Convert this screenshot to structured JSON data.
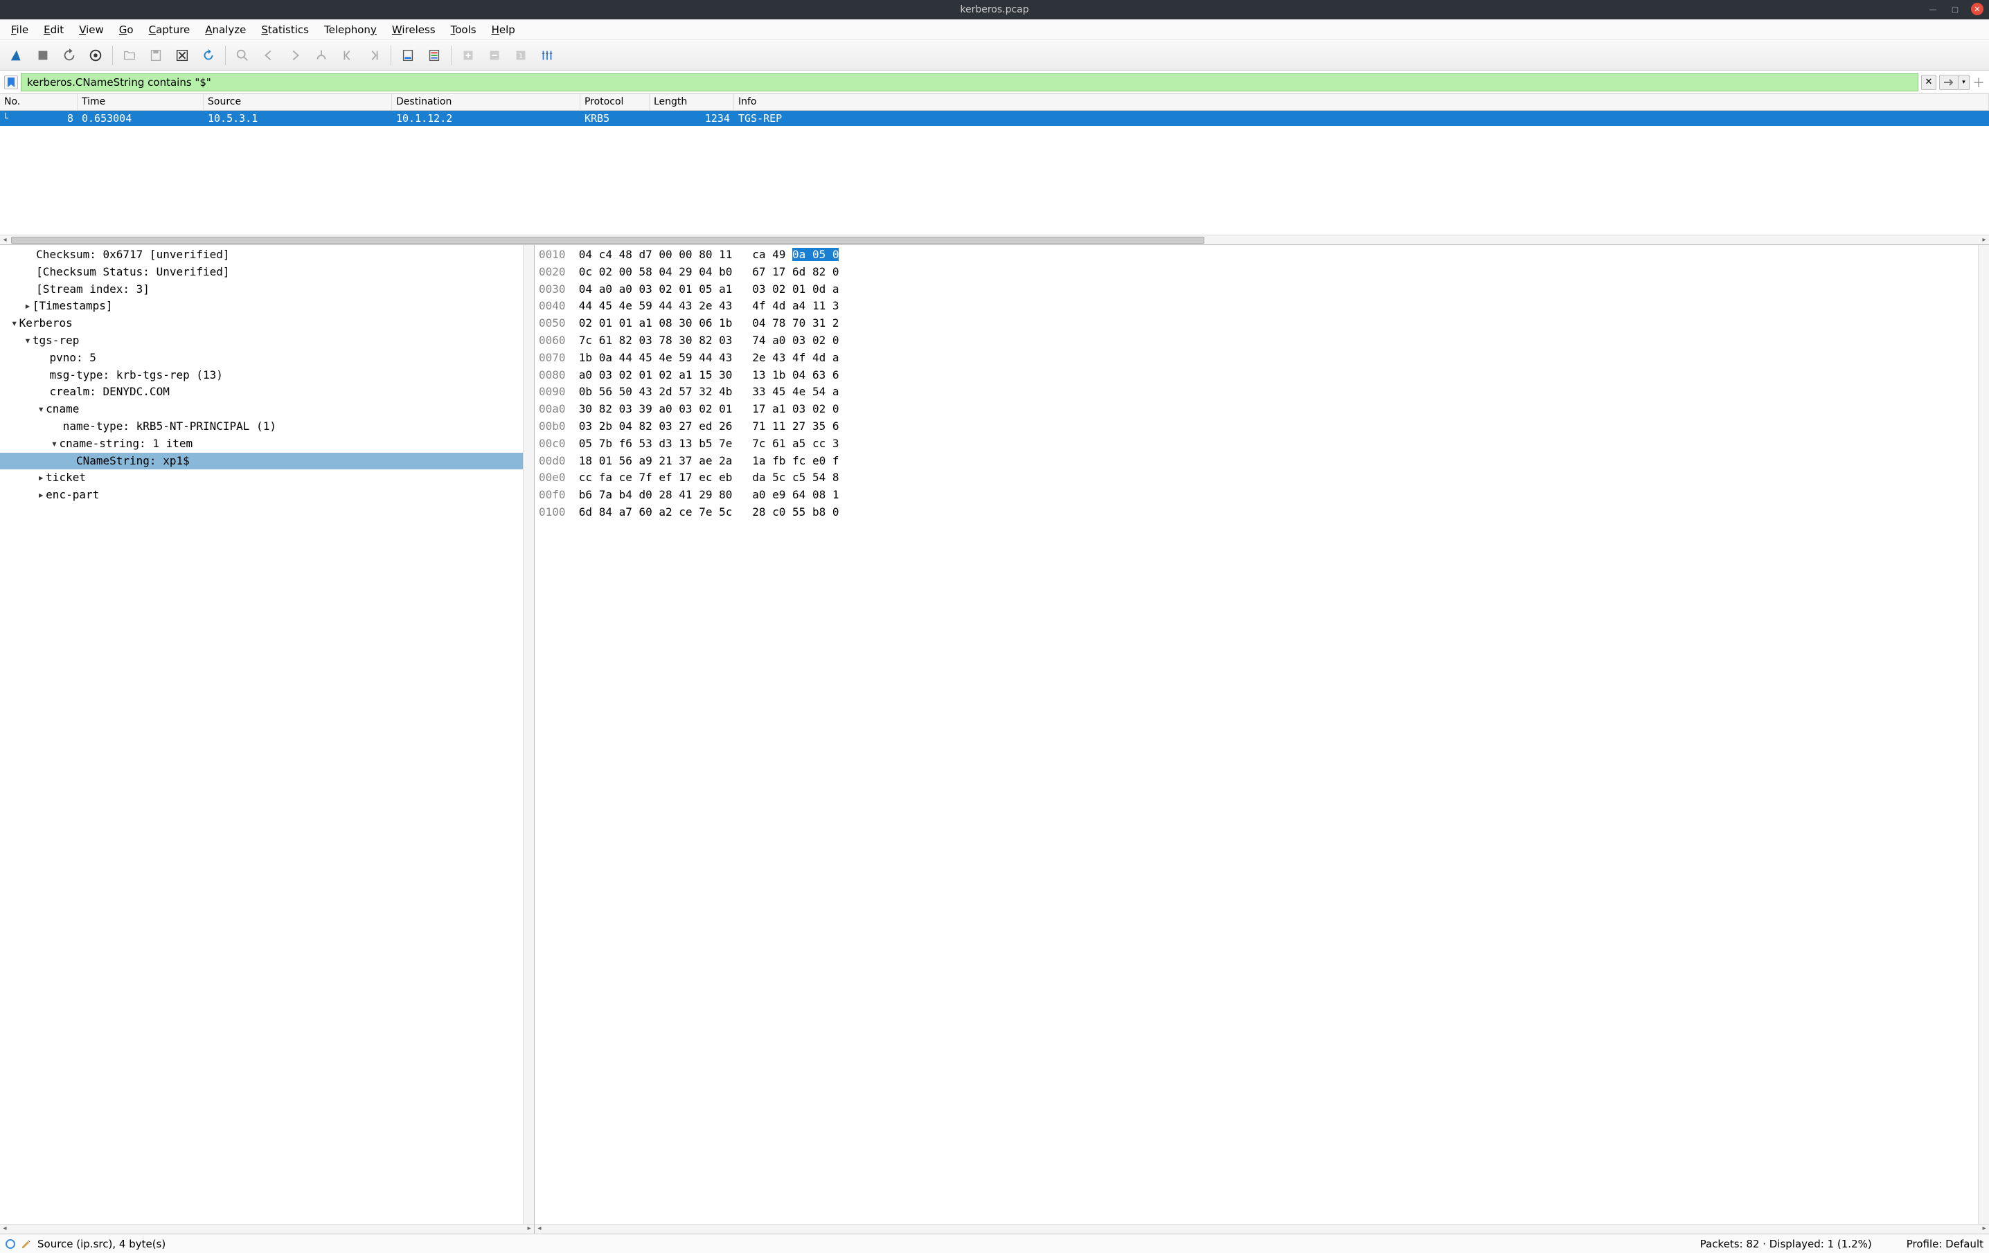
{
  "titlebar": {
    "title": "kerberos.pcap"
  },
  "menubar": {
    "file": "File",
    "edit": "Edit",
    "view": "View",
    "go": "Go",
    "capture": "Capture",
    "analyze": "Analyze",
    "statistics": "Statistics",
    "telephony": "Telephony",
    "wireless": "Wireless",
    "tools": "Tools",
    "help": "Help"
  },
  "filter": {
    "value": "kerberos.CNameString contains \"$\""
  },
  "packet_cols": {
    "no": "No.",
    "time": "Time",
    "source": "Source",
    "destination": "Destination",
    "protocol": "Protocol",
    "length": "Length",
    "info": "Info"
  },
  "packets": [
    {
      "no": "8",
      "time": "0.653004",
      "source": "10.5.3.1",
      "destination": "10.1.12.2",
      "protocol": "KRB5",
      "length": "1234",
      "info": "TGS-REP"
    }
  ],
  "tree": {
    "l0": "Checksum: 0x6717 [unverified]",
    "l1": "[Checksum Status: Unverified]",
    "l2": "[Stream index: 3]",
    "l3": "[Timestamps]",
    "l4": "Kerberos",
    "l5": "tgs-rep",
    "l6": "pvno: 5",
    "l7": "msg-type: krb-tgs-rep (13)",
    "l8": "crealm: DENYDC.COM",
    "l9": "cname",
    "l10": "name-type: kRB5-NT-PRINCIPAL (1)",
    "l11": "cname-string: 1 item",
    "l12": "CNameString: xp1$",
    "l13": "ticket",
    "l14": "enc-part"
  },
  "hex": {
    "rows": [
      {
        "off": "0010",
        "a": "04 c4 48 d7 00 00 80 11",
        "b": "ca 49 ",
        "hl": "0a 05 0"
      },
      {
        "off": "0020",
        "a": "0c 02 00 58 04 29 04 b0",
        "b": "67 17 6d 82 0"
      },
      {
        "off": "0030",
        "a": "04 a0 a0 03 02 01 05 a1",
        "b": "03 02 01 0d a"
      },
      {
        "off": "0040",
        "a": "44 45 4e 59 44 43 2e 43",
        "b": "4f 4d a4 11 3"
      },
      {
        "off": "0050",
        "a": "02 01 01 a1 08 30 06 1b",
        "b": "04 78 70 31 2"
      },
      {
        "off": "0060",
        "a": "7c 61 82 03 78 30 82 03",
        "b": "74 a0 03 02 0"
      },
      {
        "off": "0070",
        "a": "1b 0a 44 45 4e 59 44 43",
        "b": "2e 43 4f 4d a"
      },
      {
        "off": "0080",
        "a": "a0 03 02 01 02 a1 15 30",
        "b": "13 1b 04 63 6"
      },
      {
        "off": "0090",
        "a": "0b 56 50 43 2d 57 32 4b",
        "b": "33 45 4e 54 a"
      },
      {
        "off": "00a0",
        "a": "30 82 03 39 a0 03 02 01",
        "b": "17 a1 03 02 0"
      },
      {
        "off": "00b0",
        "a": "03 2b 04 82 03 27 ed 26",
        "b": "71 11 27 35 6"
      },
      {
        "off": "00c0",
        "a": "05 7b f6 53 d3 13 b5 7e",
        "b": "7c 61 a5 cc 3"
      },
      {
        "off": "00d0",
        "a": "18 01 56 a9 21 37 ae 2a",
        "b": "1a fb fc e0 f"
      },
      {
        "off": "00e0",
        "a": "cc fa ce 7f ef 17 ec eb",
        "b": "da 5c c5 54 8"
      },
      {
        "off": "00f0",
        "a": "b6 7a b4 d0 28 41 29 80",
        "b": "a0 e9 64 08 1"
      },
      {
        "off": "0100",
        "a": "6d 84 a7 60 a2 ce 7e 5c",
        "b": "28 c0 55 b8 0"
      }
    ]
  },
  "status": {
    "left": "Source (ip.src), 4 byte(s)",
    "packets": "Packets: 82 · Displayed: 1 (1.2%)",
    "profile": "Profile: Default"
  }
}
